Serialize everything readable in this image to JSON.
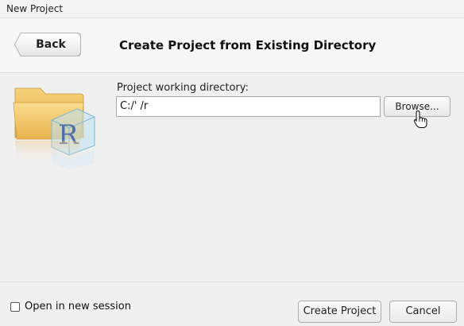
{
  "window": {
    "title": "New Project"
  },
  "header": {
    "back_label": "Back",
    "title": "Create Project from Existing Directory"
  },
  "main": {
    "directory_label": "Project working directory:",
    "directory_value": "C:/'                          /r",
    "browse_label": "Browse..."
  },
  "footer": {
    "new_session_label": "Open in new session",
    "new_session_checked": false,
    "create_label": "Create Project",
    "cancel_label": "Cancel"
  },
  "icons": {
    "project": "folder-r-icon",
    "cursor": "hand-pointer-icon"
  }
}
